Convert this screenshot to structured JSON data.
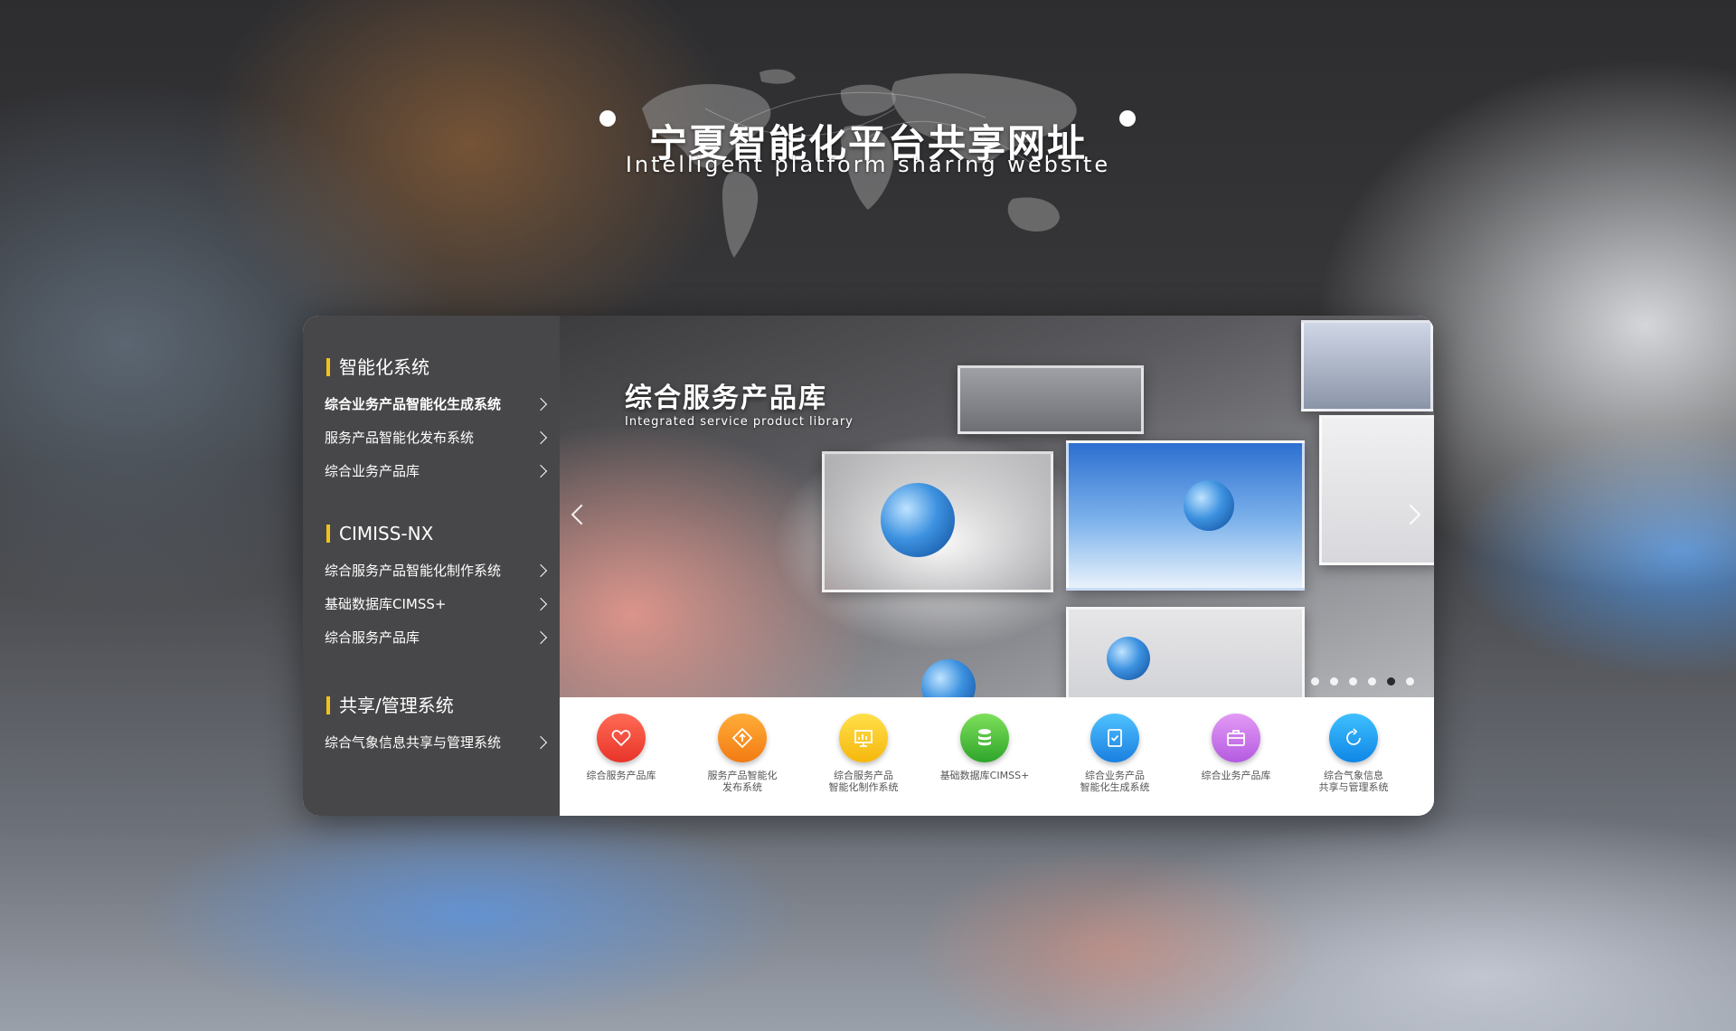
{
  "header": {
    "title_cn": "宁夏智能化平台共享网址",
    "title_en": "Intelligent platform sharing website"
  },
  "sidebar": {
    "sections": [
      {
        "heading": "智能化系统",
        "items": [
          {
            "label": "综合业务产品智能化生成系统"
          },
          {
            "label": "服务产品智能化发布系统"
          },
          {
            "label": "综合业务产品库"
          }
        ]
      },
      {
        "heading": "CIMISS-NX",
        "items": [
          {
            "label": "综合服务产品智能化制作系统"
          },
          {
            "label": "基础数据库CIMSS+"
          },
          {
            "label": "综合服务产品库"
          }
        ]
      },
      {
        "heading": "共享/管理系统",
        "items": [
          {
            "label": "综合气象信息共享与管理系统"
          }
        ]
      }
    ]
  },
  "banner": {
    "title": "综合服务产品库",
    "subtitle": "Integrated service product library",
    "slide_count": 6,
    "active_slide": 5
  },
  "quick_links": [
    {
      "label": "综合服务产品库",
      "icon": "heart-icon",
      "color_top": "#ff6b55",
      "color_bottom": "#e8342a"
    },
    {
      "label": "服务产品智能化\n发布系统",
      "icon": "upload-diamond-icon",
      "color_top": "#ffad3a",
      "color_bottom": "#f27b12"
    },
    {
      "label": "综合服务产品\n智能化制作系统",
      "icon": "monitor-chart-icon",
      "color_top": "#ffe04a",
      "color_bottom": "#f6b70c"
    },
    {
      "label": "基础数据库CIMSS+",
      "icon": "database-icon",
      "color_top": "#7ee05a",
      "color_bottom": "#2ea52a"
    },
    {
      "label": "综合业务产品\n智能化生成系统",
      "icon": "document-check-icon",
      "color_top": "#4fc2ff",
      "color_bottom": "#1a7fe0"
    },
    {
      "label": "综合业务产品库",
      "icon": "briefcase-icon",
      "color_top": "#e29af5",
      "color_bottom": "#b55be0"
    },
    {
      "label": "综合气象信息\n共享与管理系统",
      "icon": "refresh-cycle-icon",
      "color_top": "#3fc0ff",
      "color_bottom": "#0f86e6"
    }
  ]
}
